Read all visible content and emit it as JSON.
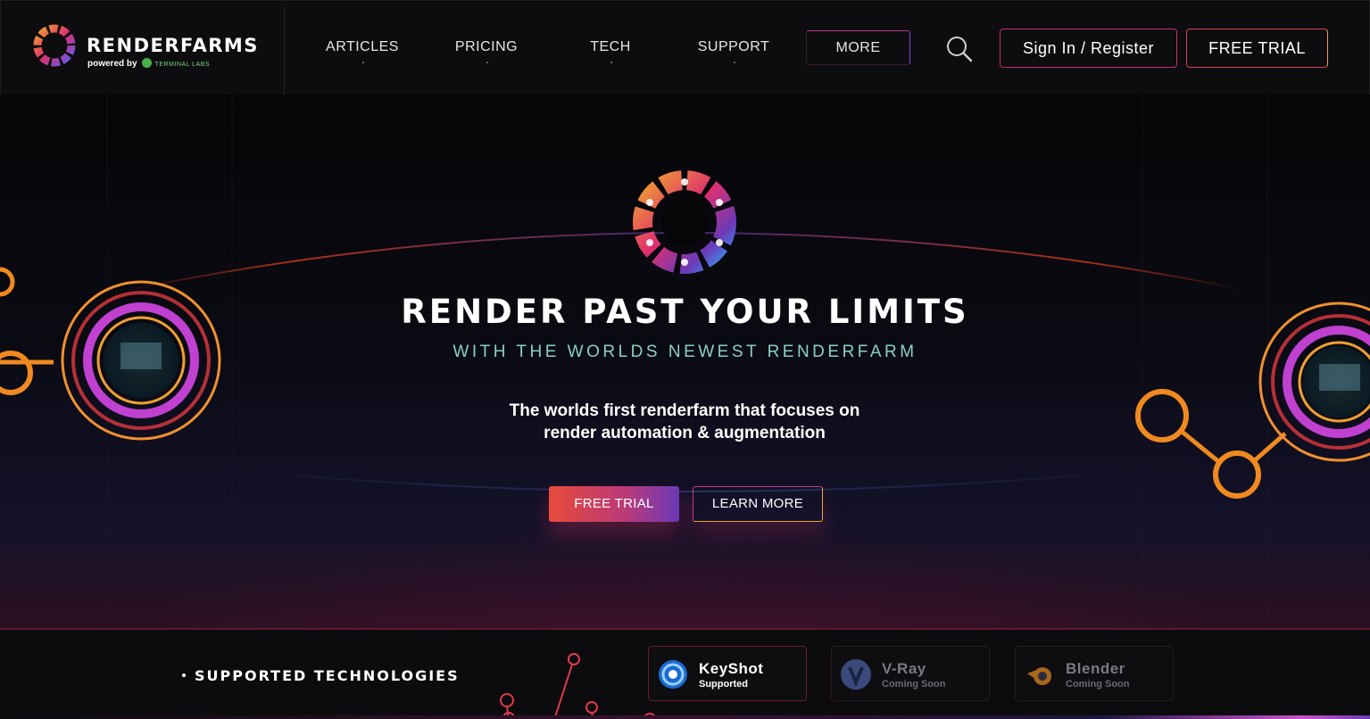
{
  "header": {
    "brand": {
      "name": "RENDERFARMS",
      "powered_by": "powered by",
      "partner": "TERMINAL LABS"
    },
    "nav": [
      {
        "label": "ARTICLES"
      },
      {
        "label": "PRICING"
      },
      {
        "label": "TECH"
      },
      {
        "label": "SUPPORT"
      },
      {
        "label": "MORE"
      }
    ],
    "search_icon": "search-icon",
    "signin_label": "Sign In / Register",
    "trial_label": "FREE TRIAL"
  },
  "hero": {
    "title": "RENDER PAST YOUR LIMITS",
    "subtitle": "WITH THE WORLDS NEWEST RENDERFARM",
    "description_line1": "The worlds first renderfarm that focuses on",
    "description_line2": "render automation & augmentation",
    "primary_cta": "FREE TRIAL",
    "secondary_cta": "LEARN MORE"
  },
  "technologies": {
    "label": "SUPPORTED TECHNOLOGIES",
    "items": [
      {
        "name": "KeyShot",
        "status": "Supported",
        "icon": "keyshot-icon"
      },
      {
        "name": "V-Ray",
        "status": "Coming Soon",
        "icon": "vray-icon"
      },
      {
        "name": "Blender",
        "status": "Coming Soon",
        "icon": "blender-icon"
      }
    ]
  },
  "colors": {
    "background": "#0b0b0e",
    "accent_pink": "#c0306e",
    "accent_orange": "#f0a030",
    "accent_purple": "#6a3ab8",
    "subtitle_teal": "#8ad0c4"
  }
}
